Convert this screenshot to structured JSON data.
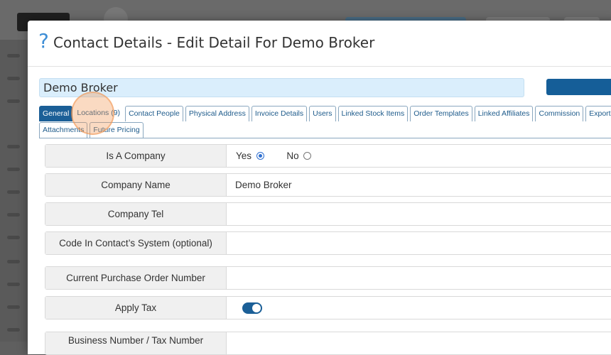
{
  "modal": {
    "help_icon": "question-mark-icon",
    "title": "Contact Details - Edit Detail For Demo Broker",
    "name_value": "Demo Broker"
  },
  "tabs": {
    "row1": [
      "General",
      "Locations (9)",
      "Contact People",
      "Physical Address",
      "Invoice Details",
      "Users",
      "Linked Stock Items",
      "Order Templates",
      "Linked Affiliates",
      "Commission",
      "Export Con"
    ],
    "row2": [
      "Attachments",
      "Future Pricing"
    ],
    "active": "General"
  },
  "form": {
    "is_company": {
      "label": "Is A Company",
      "yes": "Yes",
      "no": "No",
      "selected": "Yes"
    },
    "company_name": {
      "label": "Company Name",
      "value": "Demo Broker"
    },
    "company_tel": {
      "label": "Company Tel",
      "value": ""
    },
    "code_in_system": {
      "label": "Code In Contact’s System (optional)",
      "value": ""
    },
    "current_po": {
      "label": "Current Purchase Order Number",
      "value": ""
    },
    "apply_tax": {
      "label": "Apply Tax",
      "enabled": true
    },
    "business_number": {
      "label": "Business Number / Tax Number",
      "value": ""
    }
  },
  "colors": {
    "accent": "#1b5f97",
    "help_icon": "#3f8fd6",
    "input_bg": "#daeefc",
    "overlay": "#5f5f5f"
  }
}
